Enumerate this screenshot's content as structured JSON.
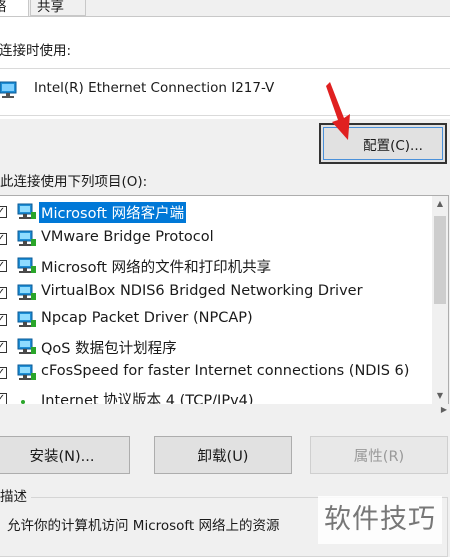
{
  "tabs": [
    {
      "label": "络"
    },
    {
      "label": "共享"
    }
  ],
  "connect_using_label": "连接时使用:",
  "adapter_name": "Intel(R) Ethernet Connection I217-V",
  "configure_button": "配置(C)...",
  "items_heading": "此连接使用下列项目(O):",
  "items": [
    {
      "label": "Microsoft 网络客户端",
      "checked": true,
      "selected": true,
      "icon": "network-client-icon"
    },
    {
      "label": "VMware Bridge Protocol",
      "checked": true,
      "icon": "network-protocol-icon"
    },
    {
      "label": "Microsoft 网络的文件和打印机共享",
      "checked": true,
      "icon": "network-service-icon"
    },
    {
      "label": "VirtualBox NDIS6 Bridged Networking Driver",
      "checked": true,
      "icon": "network-protocol-icon"
    },
    {
      "label": "Npcap Packet Driver (NPCAP)",
      "checked": true,
      "icon": "network-protocol-icon"
    },
    {
      "label": "QoS 数据包计划程序",
      "checked": true,
      "icon": "network-service-icon"
    },
    {
      "label": "cFosSpeed for faster Internet connections (NDIS 6)",
      "checked": true,
      "icon": "network-protocol-icon"
    },
    {
      "label": "Internet 协议版本 4 (TCP/IPv4)",
      "checked": true,
      "icon": "network-protocol-icon"
    }
  ],
  "buttons": {
    "install": "安装(N)...",
    "uninstall": "卸载(U)",
    "properties": "属性(R)"
  },
  "description_label": "描述",
  "description_text": "允许你的计算机访问 Microsoft 网络上的资源",
  "watermark": "软件技巧",
  "colors": {
    "selection": "#0078d7",
    "annotation_arrow": "#e02020"
  }
}
